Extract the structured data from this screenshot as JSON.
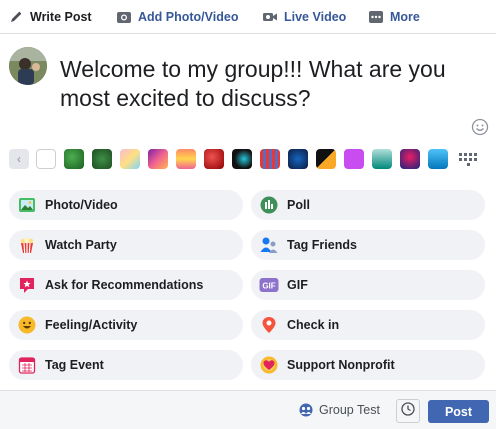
{
  "tabs": {
    "write_post": "Write Post",
    "add_photo_video": "Add Photo/Video",
    "live_video": "Live Video",
    "more": "More"
  },
  "composer": {
    "text": "Welcome to my group!!! What are you most excited to discuss?"
  },
  "backgrounds": {
    "icons": [
      "left-arrow-icon",
      "grid-icon"
    ],
    "swatch_colors": [
      "#f5f6f7",
      "#2e7d32",
      "#2e6b35",
      "#f2c94c",
      "#f06292",
      "#f2994a",
      "#c62828",
      "#1a1a1a",
      "#e53935",
      "#1e3a8a",
      "#111111",
      "#222222",
      "#c84cf0",
      "#3a9d8f",
      "#2b2b6b",
      "#1e88c8"
    ]
  },
  "options": [
    {
      "label": "Photo/Video",
      "icon": "photo-icon"
    },
    {
      "label": "Poll",
      "icon": "poll-icon"
    },
    {
      "label": "Watch Party",
      "icon": "popcorn-icon"
    },
    {
      "label": "Tag Friends",
      "icon": "tag-friends-icon"
    },
    {
      "label": "Ask for Recommendations",
      "icon": "recommendation-icon"
    },
    {
      "label": "GIF",
      "icon": "gif-icon"
    },
    {
      "label": "Feeling/Activity",
      "icon": "smiley-icon"
    },
    {
      "label": "Check in",
      "icon": "location-pin-icon"
    },
    {
      "label": "Tag Event",
      "icon": "calendar-icon"
    },
    {
      "label": "Support Nonprofit",
      "icon": "heart-donate-icon"
    }
  ],
  "footer": {
    "audience": "Group Test",
    "post_label": "Post"
  },
  "colors": {
    "accent": "#4267b2",
    "link": "#365899",
    "pill_bg": "#f0f2f5"
  }
}
